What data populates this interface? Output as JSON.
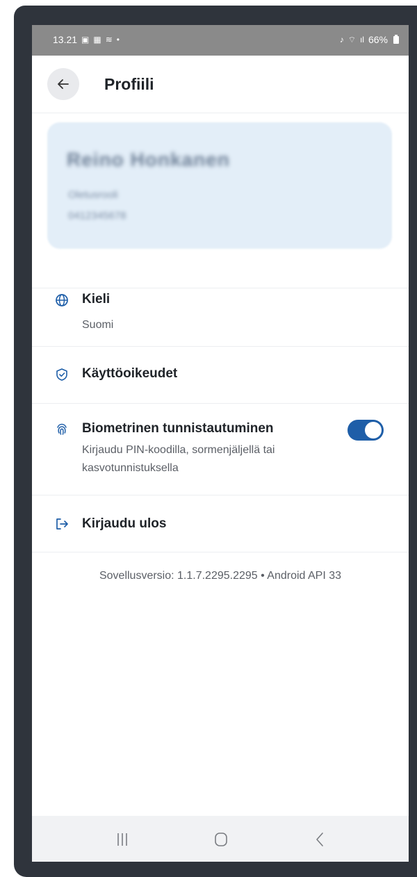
{
  "status_bar": {
    "time": "13.21",
    "notification_icons": [
      "image-icon",
      "grid-icon",
      "cast-icon",
      "dot-icon"
    ],
    "battery": "66%"
  },
  "header": {
    "title": "Profiili",
    "back_icon": "arrow-left-icon"
  },
  "profile": {
    "name": "Reino Honkanen",
    "line1": "Oletusrooli",
    "line2": "0412345678"
  },
  "settings": [
    {
      "icon": "globe-icon",
      "title": "Kieli",
      "subtitle": "Suomi"
    },
    {
      "icon": "shield-check-icon",
      "title": "Käyttöoikeudet"
    },
    {
      "icon": "fingerprint-icon",
      "title": "Biometrinen tunnistautuminen",
      "subtitle_line1": "Kirjaudu PIN-koodilla, sormenjäljellä tai",
      "subtitle_line2": "kasvotunnistuksella",
      "toggle_on": true
    },
    {
      "icon": "logout-icon",
      "title": "Kirjaudu ulos"
    }
  ],
  "version": "Sovellusversio: 1.1.7.2295.2295 • Android API 33",
  "colors": {
    "accent": "#1e5ea8",
    "profile_card": "#e3eef8",
    "frame": "#2f343c"
  }
}
